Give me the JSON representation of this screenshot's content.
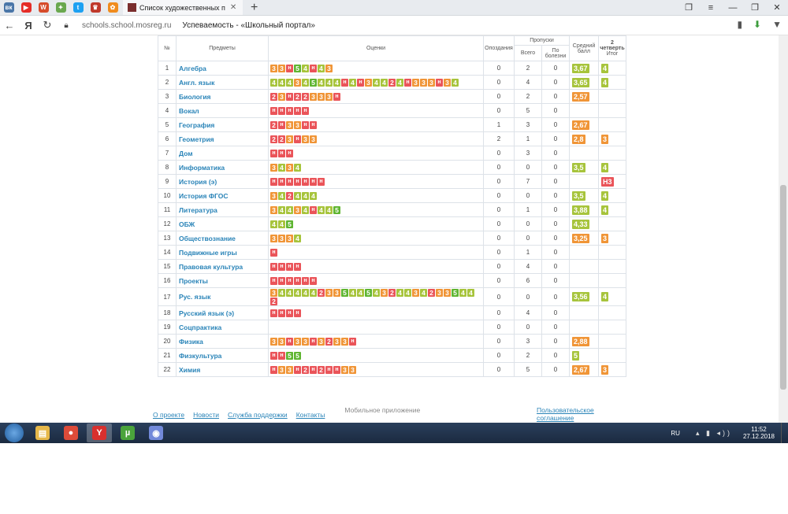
{
  "browser": {
    "tab_title": "Список художественных п",
    "url": "schools.school.mosreg.ru",
    "page_title": "Успеваемость - «Школьный портал»",
    "logo": "Я",
    "pinned_tabs": [
      {
        "icon": "vk-icon",
        "text": "вк",
        "color": "#4a76a8"
      },
      {
        "icon": "youtube-icon",
        "text": "▶",
        "color": "#e52d27"
      },
      {
        "icon": "wattpad-icon",
        "text": "W",
        "color": "#d64c2b"
      },
      {
        "icon": "game-icon",
        "text": "✦",
        "color": "#6aa84f"
      },
      {
        "icon": "twitter-icon",
        "text": "t",
        "color": "#1da1f2"
      },
      {
        "icon": "coat-of-arms-icon",
        "text": "♛",
        "color": "#c0392b"
      },
      {
        "icon": "ok-icon",
        "text": "✿",
        "color": "#f08c1e"
      }
    ]
  },
  "table": {
    "headers": {
      "num": "№",
      "subject": "Предметы",
      "grades": "Оценки",
      "late": "Опоздания",
      "absences": "Пропуски",
      "total": "Всего",
      "illness": "По болезни",
      "avg": "Средний балл",
      "quarter": "2 четверть",
      "final": "Итог"
    },
    "rows": [
      {
        "n": "1",
        "subject": "Алгебра",
        "grades": [
          "3",
          "3",
          "н",
          "5",
          "4",
          "н",
          "4",
          "3"
        ],
        "late": "0",
        "total": "2",
        "ill": "0",
        "avg": "3,67",
        "final": "4"
      },
      {
        "n": "2",
        "subject": "Англ. язык",
        "grades": [
          "4",
          "4",
          "4",
          "3",
          "4",
          "5",
          "4",
          "4",
          "4",
          "н",
          "4",
          "н",
          "3",
          "4",
          "4",
          "2",
          "4",
          "н",
          "3",
          "3",
          "3",
          "н",
          "3",
          "4"
        ],
        "late": "0",
        "total": "4",
        "ill": "0",
        "avg": "3,65",
        "final": "4"
      },
      {
        "n": "3",
        "subject": "Биология",
        "grades": [
          "2",
          "3",
          "н",
          "2",
          "2",
          "3",
          "3",
          "3",
          "н"
        ],
        "late": "0",
        "total": "2",
        "ill": "0",
        "avg": "2,57",
        "final": ""
      },
      {
        "n": "4",
        "subject": "Вокал",
        "grades": [
          "н",
          "н",
          "н",
          "н",
          "н"
        ],
        "late": "0",
        "total": "5",
        "ill": "0",
        "avg": "",
        "final": ""
      },
      {
        "n": "5",
        "subject": "География",
        "grades": [
          "2",
          "н",
          "3",
          "3",
          "н",
          "н"
        ],
        "late": "1",
        "total": "3",
        "ill": "0",
        "avg": "2,67",
        "final": ""
      },
      {
        "n": "6",
        "subject": "Геометрия",
        "grades": [
          "2",
          "2",
          "3",
          "н",
          "3",
          "3"
        ],
        "late": "2",
        "total": "1",
        "ill": "0",
        "avg": "2,8",
        "final": "3"
      },
      {
        "n": "7",
        "subject": "Дом",
        "grades": [
          "н",
          "н",
          "н"
        ],
        "late": "0",
        "total": "3",
        "ill": "0",
        "avg": "",
        "final": ""
      },
      {
        "n": "8",
        "subject": "Информатика",
        "grades": [
          "3",
          "4",
          "3",
          "4"
        ],
        "late": "0",
        "total": "0",
        "ill": "0",
        "avg": "3,5",
        "final": "4"
      },
      {
        "n": "9",
        "subject": "История (э)",
        "grades": [
          "н",
          "н",
          "н",
          "н",
          "н",
          "н",
          "н"
        ],
        "late": "0",
        "total": "7",
        "ill": "0",
        "avg": "",
        "final": "Н3"
      },
      {
        "n": "10",
        "subject": "История ФГОС",
        "grades": [
          "3",
          "4",
          "2",
          "4",
          "4",
          "4"
        ],
        "late": "0",
        "total": "0",
        "ill": "0",
        "avg": "3,5",
        "final": "4"
      },
      {
        "n": "11",
        "subject": "Литература",
        "grades": [
          "3",
          "4",
          "4",
          "3",
          "4",
          "н",
          "4",
          "4",
          "5"
        ],
        "late": "0",
        "total": "1",
        "ill": "0",
        "avg": "3,88",
        "final": "4"
      },
      {
        "n": "12",
        "subject": "ОБЖ",
        "grades": [
          "4",
          "4",
          "5"
        ],
        "late": "0",
        "total": "0",
        "ill": "0",
        "avg": "4,33",
        "final": ""
      },
      {
        "n": "13",
        "subject": "Обществознание",
        "grades": [
          "3",
          "3",
          "3",
          "4"
        ],
        "late": "0",
        "total": "0",
        "ill": "0",
        "avg": "3,25",
        "final": "3"
      },
      {
        "n": "14",
        "subject": "Подвижные игры",
        "grades": [
          "н"
        ],
        "late": "0",
        "total": "1",
        "ill": "0",
        "avg": "",
        "final": ""
      },
      {
        "n": "15",
        "subject": "Правовая культура",
        "grades": [
          "н",
          "н",
          "н",
          "н"
        ],
        "late": "0",
        "total": "4",
        "ill": "0",
        "avg": "",
        "final": ""
      },
      {
        "n": "16",
        "subject": "Проекты",
        "grades": [
          "н",
          "н",
          "н",
          "н",
          "н",
          "н"
        ],
        "late": "0",
        "total": "6",
        "ill": "0",
        "avg": "",
        "final": ""
      },
      {
        "n": "17",
        "subject": "Рус. язык",
        "grades": [
          "3",
          "4",
          "4",
          "4",
          "4",
          "4",
          "2",
          "3",
          "3",
          "5",
          "4",
          "4",
          "5",
          "4",
          "3",
          "2",
          "4",
          "4",
          "3",
          "4",
          "2",
          "3",
          "3",
          "5",
          "4",
          "4",
          "2"
        ],
        "late": "0",
        "total": "0",
        "ill": "0",
        "avg": "3,56",
        "final": "4"
      },
      {
        "n": "18",
        "subject": "Русский язык (э)",
        "grades": [
          "н",
          "н",
          "н",
          "н"
        ],
        "late": "0",
        "total": "4",
        "ill": "0",
        "avg": "",
        "final": ""
      },
      {
        "n": "19",
        "subject": "Соцпрактика",
        "grades": [],
        "late": "0",
        "total": "0",
        "ill": "0",
        "avg": "",
        "final": ""
      },
      {
        "n": "20",
        "subject": "Физика",
        "grades": [
          "3",
          "3",
          "н",
          "3",
          "3",
          "н",
          "3",
          "2",
          "3",
          "3",
          "н"
        ],
        "late": "0",
        "total": "3",
        "ill": "0",
        "avg": "2,88",
        "final": ""
      },
      {
        "n": "21",
        "subject": "Физкультура",
        "grades": [
          "н",
          "н",
          "5",
          "5"
        ],
        "late": "0",
        "total": "2",
        "ill": "0",
        "avg": "5",
        "final": ""
      },
      {
        "n": "22",
        "subject": "Химия",
        "grades": [
          "н",
          "3",
          "3",
          "н",
          "2",
          "н",
          "2",
          "н",
          "н",
          "3",
          "3"
        ],
        "late": "0",
        "total": "5",
        "ill": "0",
        "avg": "2,67",
        "final": "3"
      }
    ]
  },
  "colors": {
    "5": "#5fb531",
    "4": "#a7c43c",
    "3": "#f09537",
    "2": "#ea5459",
    "н": "#ea5459"
  },
  "footer": {
    "links": [
      "О проекте",
      "Новости",
      "Служба поддержки",
      "Контакты"
    ],
    "mobile": "Мобильное приложение",
    "agreement": "Пользовательское соглашение"
  },
  "taskbar": {
    "lang": "RU",
    "time": "11:52",
    "date": "27.12.2018",
    "apps": [
      {
        "icon": "explorer-icon",
        "text": "▤",
        "color": "#e6b84a"
      },
      {
        "icon": "chrome-icon",
        "text": "●",
        "color": "#dd4b39"
      },
      {
        "icon": "yandex-browser-icon",
        "text": "Y",
        "color": "#d8302e"
      },
      {
        "icon": "utorrent-icon",
        "text": "µ",
        "color": "#4aa33b"
      },
      {
        "icon": "discord-icon",
        "text": "◉",
        "color": "#7289da"
      }
    ]
  }
}
